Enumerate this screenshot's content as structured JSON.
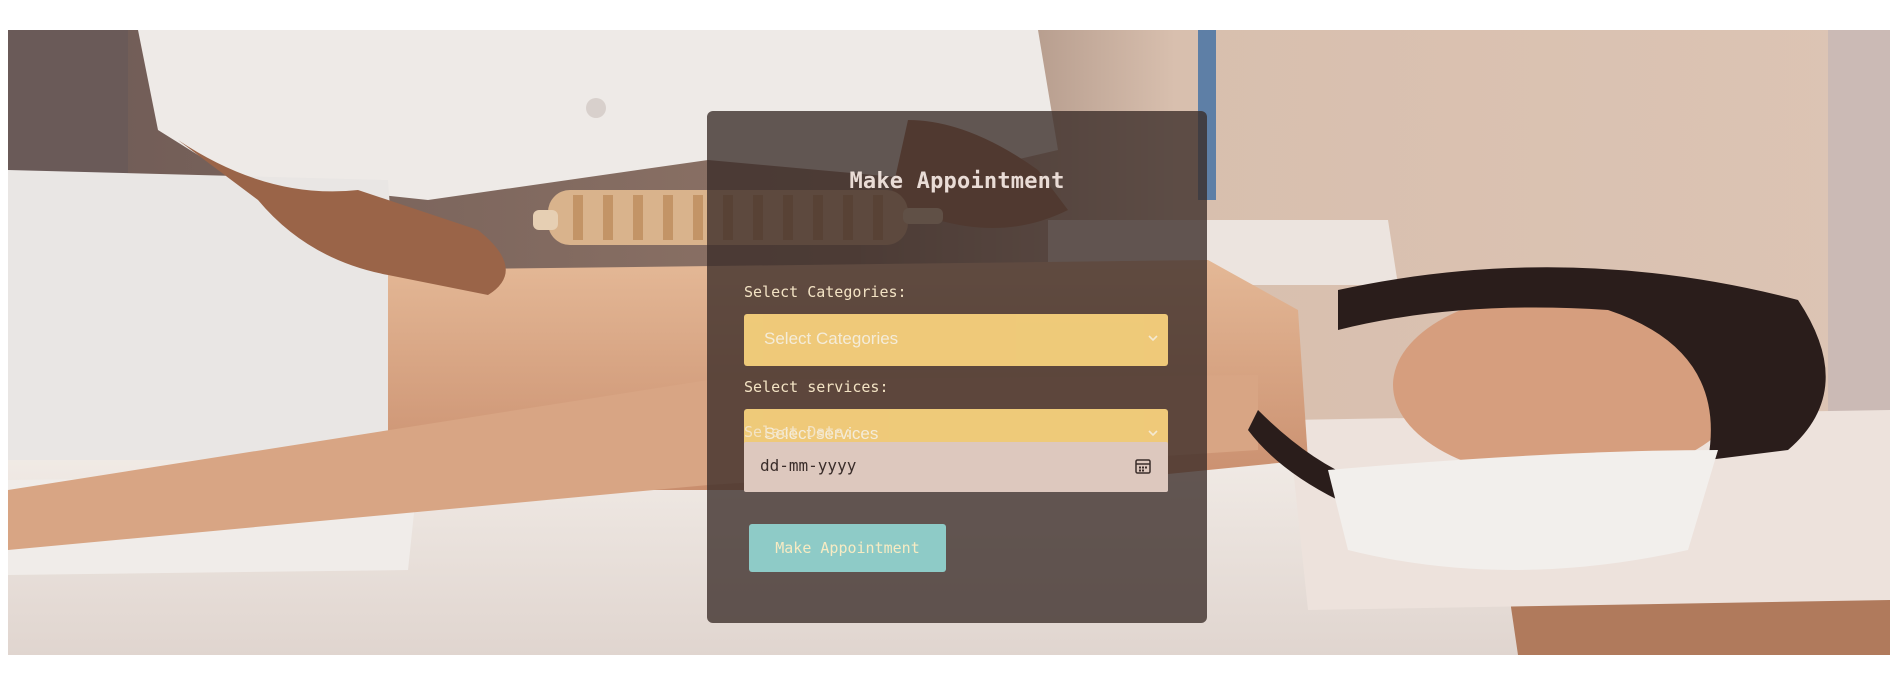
{
  "form": {
    "title": "Make Appointment",
    "category_label": "Select Categories:",
    "category_placeholder": "Select Categories",
    "service_label": "Select services:",
    "service_placeholder": "Select services",
    "date_label": "Select Date:",
    "date_placeholder": "dd-mm-yyyy",
    "submit_label": "Make Appointment"
  },
  "colors": {
    "panel_overlay": "#3a2c28",
    "select_fill": "#f5cf7c",
    "button_fill": "#8ecbc7",
    "button_text": "#f7ebc3"
  },
  "icons": {
    "select_arrow": "chevron-down-icon",
    "date_picker": "calendar-icon"
  }
}
